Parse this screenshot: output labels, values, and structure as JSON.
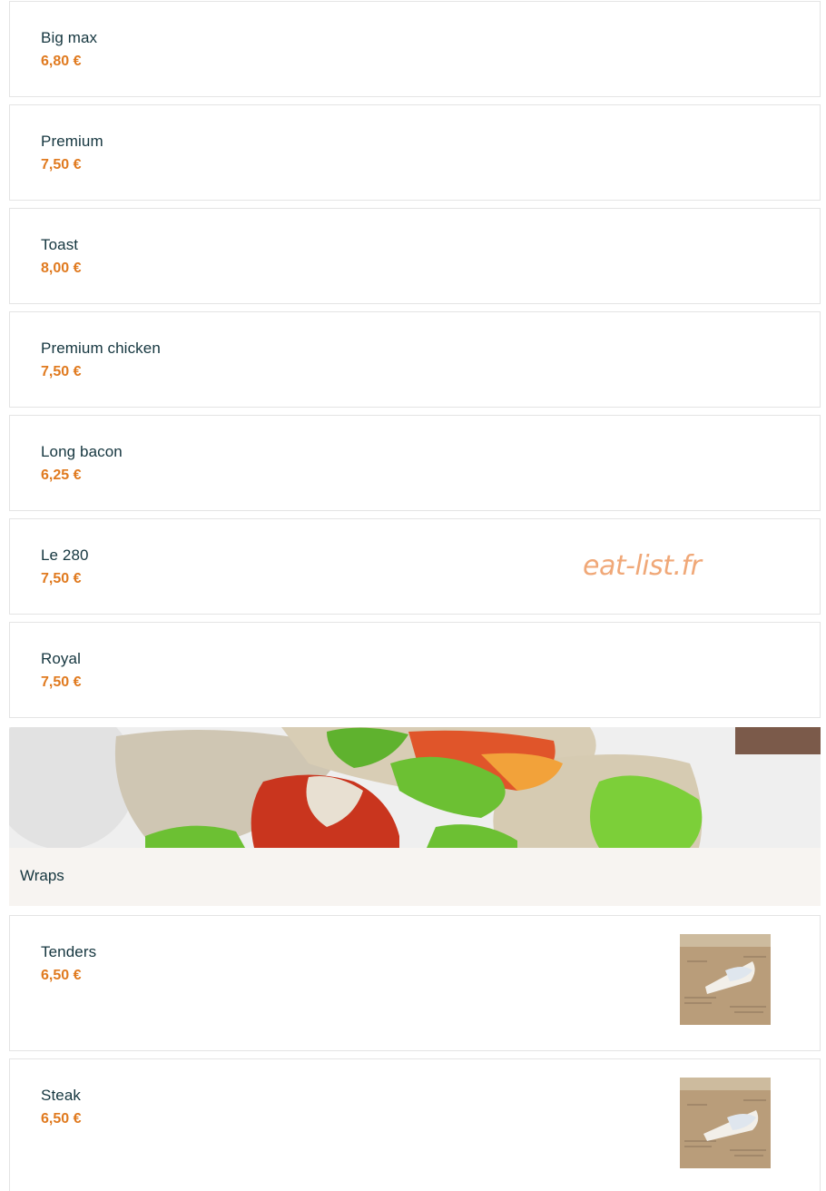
{
  "items": [
    {
      "name": "Big max",
      "price": "6,80 €"
    },
    {
      "name": "Premium",
      "price": "7,50 €"
    },
    {
      "name": "Toast",
      "price": "8,00 €"
    },
    {
      "name": "Premium chicken",
      "price": "7,50 €"
    },
    {
      "name": "Long bacon",
      "price": "6,25 €"
    },
    {
      "name": "Le 280",
      "price": "7,50 €"
    },
    {
      "name": "Royal",
      "price": "7,50 €"
    }
  ],
  "watermark": "eat-list.fr",
  "section": {
    "title": "Wraps",
    "items": [
      {
        "name": "Tenders",
        "price": "6,50 €"
      },
      {
        "name": "Steak",
        "price": "6,50 €"
      }
    ]
  },
  "colors": {
    "price": "#e07a1f",
    "text": "#15363f",
    "border": "#e4e4e4",
    "section_bg": "#f7f4f1",
    "watermark": "#f0a878"
  }
}
